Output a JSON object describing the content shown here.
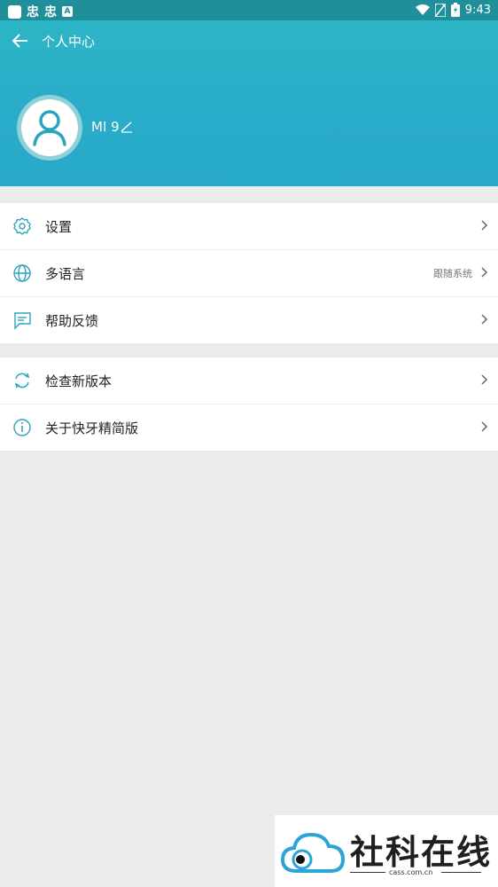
{
  "status_bar": {
    "time": "9:43"
  },
  "header": {
    "title": "个人中心",
    "username": "MI 9"
  },
  "menu_group1": [
    {
      "label": "设置",
      "sub": ""
    },
    {
      "label": "多语言",
      "sub": "跟随系统"
    },
    {
      "label": "帮助反馈",
      "sub": ""
    }
  ],
  "menu_group2": [
    {
      "label": "检查新版本",
      "sub": ""
    },
    {
      "label": "关于快牙精简版",
      "sub": ""
    }
  ],
  "watermark": {
    "text": "社科在线",
    "url": "cass.com.cn"
  },
  "colors": {
    "header": "#2bb3c7",
    "accent_icon": "#2aa5bd"
  }
}
